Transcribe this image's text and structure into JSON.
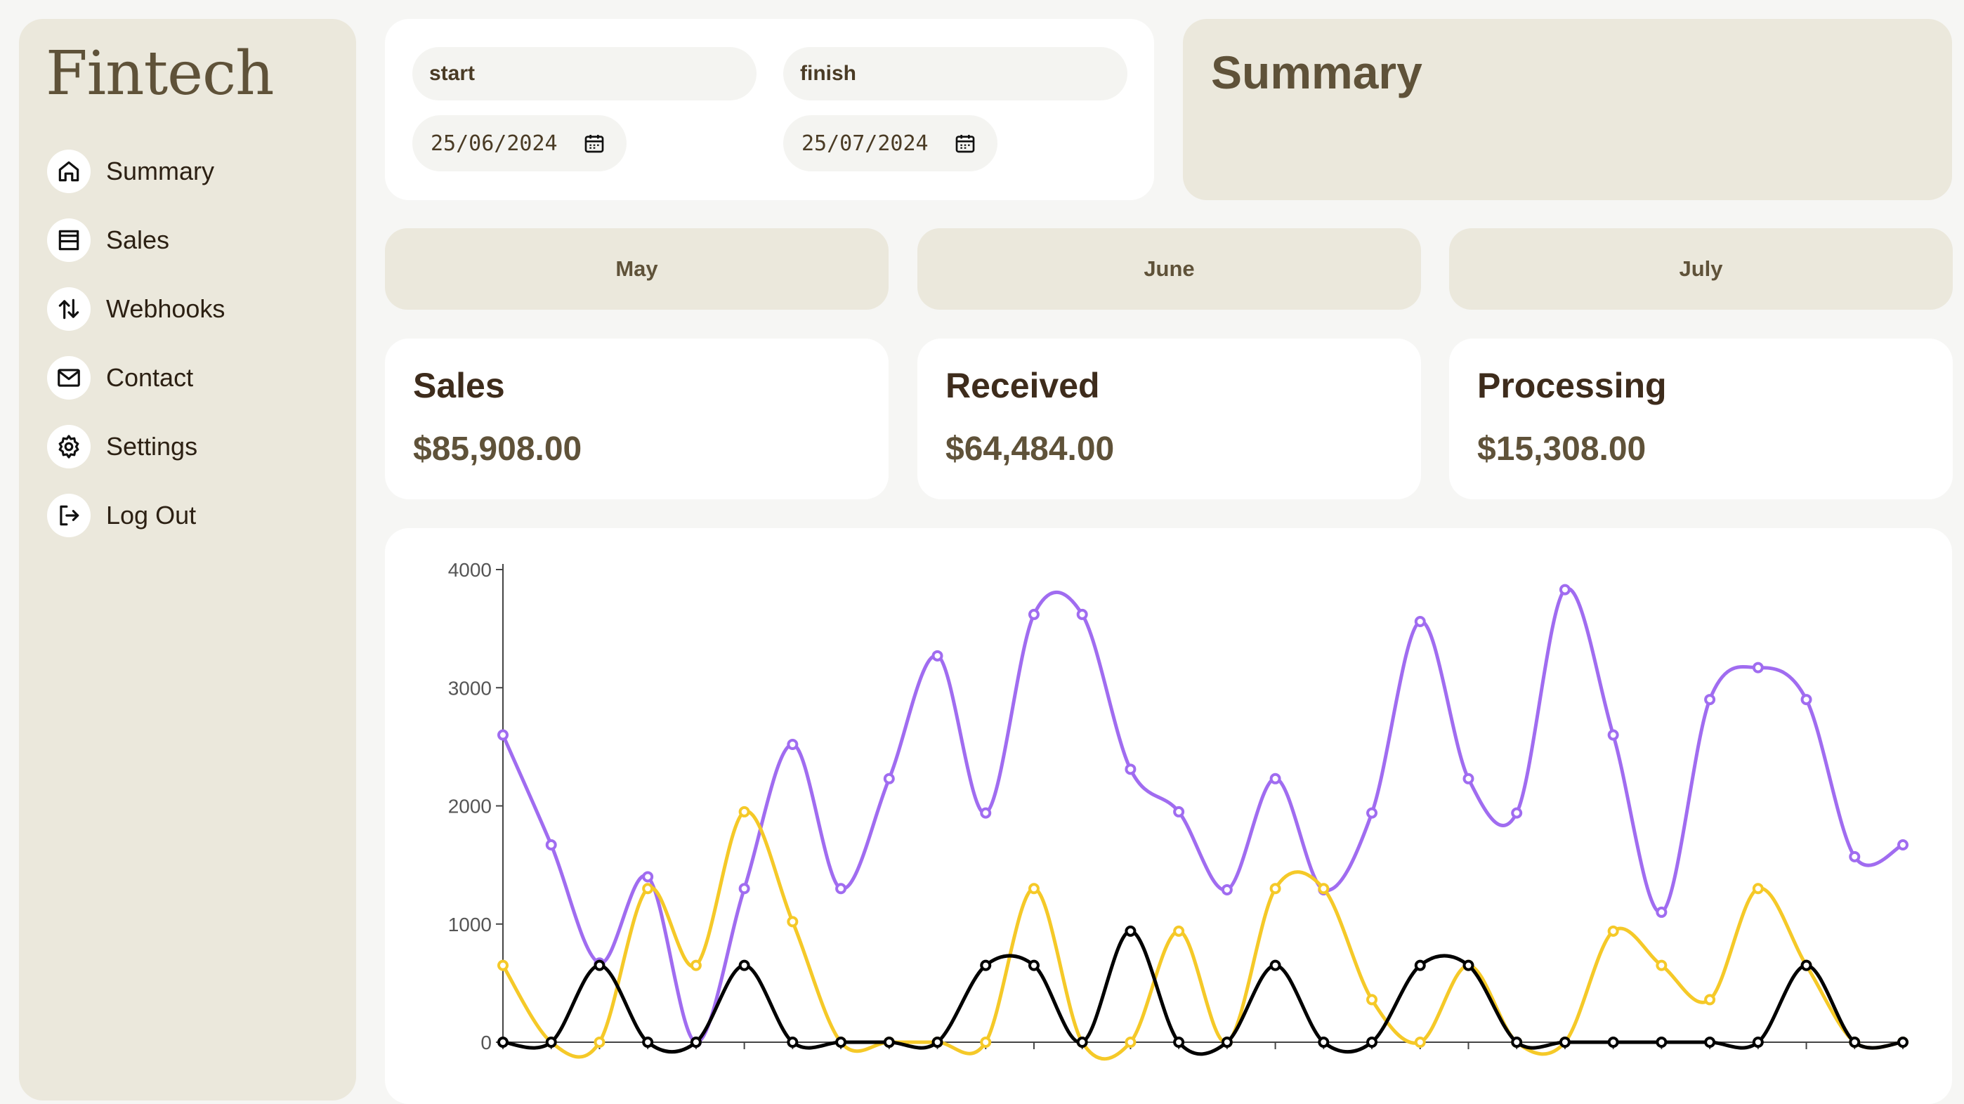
{
  "app": {
    "logo": "Fintech"
  },
  "sidebar": {
    "items": [
      {
        "label": "Summary",
        "icon": "home-icon"
      },
      {
        "label": "Sales",
        "icon": "store-icon"
      },
      {
        "label": "Webhooks",
        "icon": "arrows-up-down-icon"
      },
      {
        "label": "Contact",
        "icon": "mail-icon"
      },
      {
        "label": "Settings",
        "icon": "gear-icon"
      },
      {
        "label": "Log Out",
        "icon": "logout-icon"
      }
    ]
  },
  "date_range": {
    "start_label": "start",
    "finish_label": "finish",
    "start_value": "25/06/2024",
    "finish_value": "25/07/2024"
  },
  "summary": {
    "title": "Summary"
  },
  "months": [
    "May",
    "June",
    "July"
  ],
  "stats": [
    {
      "title": "Sales",
      "value": "$85,908.00"
    },
    {
      "title": "Received",
      "value": "$64,484.00"
    },
    {
      "title": "Processing",
      "value": "$15,308.00"
    }
  ],
  "colors": {
    "purple": "#a06cf0",
    "yellow": "#f5c928",
    "black": "#000000",
    "beige": "#ebe8dc",
    "brown": "#5f5239"
  },
  "chart_data": {
    "type": "line",
    "ylim": [
      0,
      4000
    ],
    "yticks": [
      "0",
      "1000",
      "2000",
      "3000",
      "4000"
    ],
    "x": [
      1,
      2,
      3,
      4,
      5,
      6,
      7,
      8,
      9,
      10,
      11,
      12,
      13,
      14,
      15,
      16,
      17,
      18,
      19,
      20,
      21,
      22,
      23,
      24,
      25,
      26,
      27,
      28,
      29,
      30
    ],
    "series": [
      {
        "color": "#a06cf0",
        "values": [
          2600,
          1670,
          670,
          1400,
          0,
          1300,
          2520,
          1300,
          2230,
          3270,
          1940,
          3620,
          3620,
          2310,
          1950,
          1290,
          2230,
          1290,
          1940,
          3560,
          2230,
          1940,
          3830,
          2600,
          1100,
          2900,
          3170,
          2900,
          1570,
          1670
        ]
      },
      {
        "color": "#f5c928",
        "values": [
          650,
          0,
          0,
          1300,
          650,
          1950,
          1020,
          0,
          0,
          0,
          0,
          1300,
          0,
          0,
          940,
          0,
          1300,
          1300,
          360,
          0,
          650,
          0,
          0,
          940,
          650,
          360,
          1300,
          650,
          0,
          0
        ]
      },
      {
        "color": "#000000",
        "values": [
          0,
          0,
          650,
          0,
          0,
          650,
          0,
          0,
          0,
          0,
          650,
          650,
          0,
          940,
          0,
          0,
          650,
          0,
          0,
          650,
          650,
          0,
          0,
          0,
          0,
          0,
          0,
          650,
          0,
          0
        ]
      }
    ]
  }
}
